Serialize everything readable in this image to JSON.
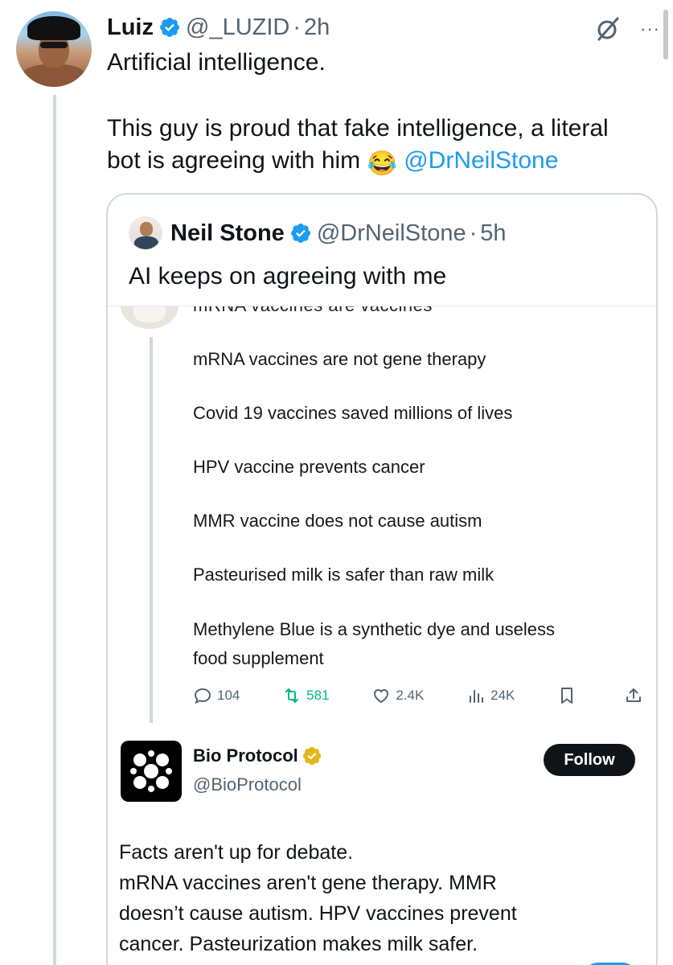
{
  "tweet": {
    "author_name": "Luiz",
    "author_handle": "@_LUZID",
    "dot": "·",
    "time": "2h",
    "line_1": "Artificial intelligence.",
    "line_2": "This guy is proud that fake intelligence, a literal",
    "line_3_prefix": "bot is agreeing with him",
    "emoji": "😂",
    "mention": "@DrNeilStone",
    "more_label": "···"
  },
  "quote": {
    "author_name": "Neil Stone",
    "author_handle": "@DrNeilStone",
    "dot": "·",
    "time": "5h",
    "text": "AI keeps on agreeing with me",
    "screenshot": {
      "cut_off_line": "mRNA vaccines are vaccines",
      "items": [
        "mRNA vaccines are not gene therapy",
        "Covid 19 vaccines saved millions of lives",
        "HPV vaccine prevents cancer",
        "MMR vaccine does not cause autism",
        "Pasteurised milk is safer than raw milk",
        "Methylene Blue is a synthetic dye and useless",
        "food supplement"
      ],
      "actions": {
        "replies": "104",
        "reposts": "581",
        "likes": "2.4K",
        "views": "24K"
      },
      "reply": {
        "name": "Bio Protocol",
        "handle": "@BioProtocol",
        "follow_label": "Follow",
        "lines": [
          "Facts aren't up for debate.",
          "mRNA vaccines aren't gene therapy. MMR",
          "doesn’t cause autism. HPV vaccines prevent",
          "cancer. Pasteurization makes milk safer."
        ]
      }
    }
  },
  "colors": {
    "link": "#1d9bf0",
    "text": "#0f1419",
    "muted": "#536471",
    "repost": "#00ba7c",
    "gold_badge": "#e2b719",
    "border": "#cfd9de"
  },
  "icons": [
    "verified-badge-icon",
    "grok-icon",
    "more-icon",
    "reply-icon",
    "repost-icon",
    "like-icon",
    "views-icon",
    "bookmark-icon",
    "share-icon",
    "bio-protocol-logo-icon",
    "gold-badge-icon"
  ]
}
